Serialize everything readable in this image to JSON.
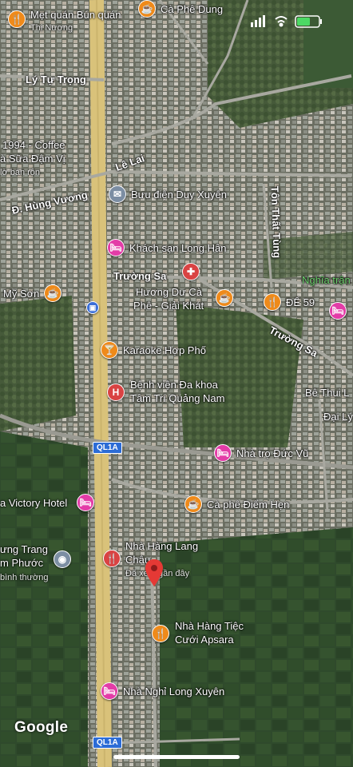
{
  "map": {
    "attribution": "Google",
    "places": [
      {
        "id": "met-quan",
        "text": "Mẹt quán Bún quán",
        "kind": "orange",
        "glyph": "🍴"
      },
      {
        "id": "met-quan-sub",
        "text": "Thị Nương"
      },
      {
        "id": "ca-phe-dung",
        "text": "Cà Phê Dung",
        "kind": "orange",
        "glyph": "☕"
      },
      {
        "id": "coffee-1994",
        "text": "1994 - Coffee"
      },
      {
        "id": "sua-dam-vi",
        "text": "à Sữa Đậm Vị"
      },
      {
        "id": "sua-dam-vi-sub",
        "text": "lờ bán rộn"
      },
      {
        "id": "buu-dien",
        "text": "Bưu điện Duy Xuyên",
        "kind": "grey",
        "glyph": "✉"
      },
      {
        "id": "khach-san",
        "text": "Khách sạn Long Hân",
        "kind": "pink",
        "glyph": "🛏"
      },
      {
        "id": "huong-du",
        "text": "Hương Dư Cà",
        "kind": "orange",
        "glyph": "☕"
      },
      {
        "id": "huong-du-2",
        "text": "Phê - Giải Khát"
      },
      {
        "id": "my-son",
        "text": "Mỹ Sơn",
        "kind": "orange",
        "glyph": "☕"
      },
      {
        "id": "de-59",
        "text": "ĐỂ 59",
        "kind": "orange",
        "glyph": "🍴"
      },
      {
        "id": "nghia-trang",
        "text": "Nghĩa trận"
      },
      {
        "id": "karaoke",
        "text": "Karaoke Hợp Phố",
        "kind": "orange",
        "glyph": "🍸"
      },
      {
        "id": "benh-vien",
        "text": "Bệnh viện Đa khoa",
        "kind": "red",
        "glyph": "H"
      },
      {
        "id": "benh-vien-2",
        "text": "Tâm Trí Quảng Nam"
      },
      {
        "id": "be-thui",
        "text": "Bê Thui L"
      },
      {
        "id": "dai-ly",
        "text": "Đại Lý"
      },
      {
        "id": "nha-tro",
        "text": "Nhà trọ Đức Vũ",
        "kind": "pink",
        "glyph": "🛏"
      },
      {
        "id": "victory",
        "text": "a Victory Hotel",
        "kind": "pink",
        "glyph": "🛏"
      },
      {
        "id": "ca-phe-diem-hen",
        "text": "Cà phê Điểm Hẹn",
        "kind": "orange",
        "glyph": "☕"
      },
      {
        "id": "nha-hang-lang",
        "text": "Nhà Hàng Lang",
        "kind": "red",
        "glyph": "🍴"
      },
      {
        "id": "nha-hang-lang-2",
        "text": "Châu"
      },
      {
        "id": "da-xem",
        "text": "Đã xem gần đây"
      },
      {
        "id": "ung-trang",
        "text": "ưng Trang"
      },
      {
        "id": "m-phuoc",
        "text": "m Phước"
      },
      {
        "id": "binh-thuong",
        "text": "bình thường"
      },
      {
        "id": "apsara",
        "text": "Nhà Hàng Tiệc",
        "kind": "orange",
        "glyph": "🍴"
      },
      {
        "id": "apsara-2",
        "text": "Cưới Apsara"
      },
      {
        "id": "nha-nghi",
        "text": "Nhà Nghỉ Long Xuyên",
        "kind": "pink",
        "glyph": "🛏"
      }
    ],
    "roads": {
      "ly_tu_trong": "Lý Tự Trọng",
      "le_lai": "Lê Lai",
      "hung_vuong": "Đ. Hùng Vương",
      "truong_sa_1": "Trường Sa",
      "truong_sa_2": "Trường Sa",
      "ton_that_tung": "Tôn Thất Tùng",
      "ql1a_1": "QL1A",
      "ql1a_2": "QL1A"
    }
  }
}
